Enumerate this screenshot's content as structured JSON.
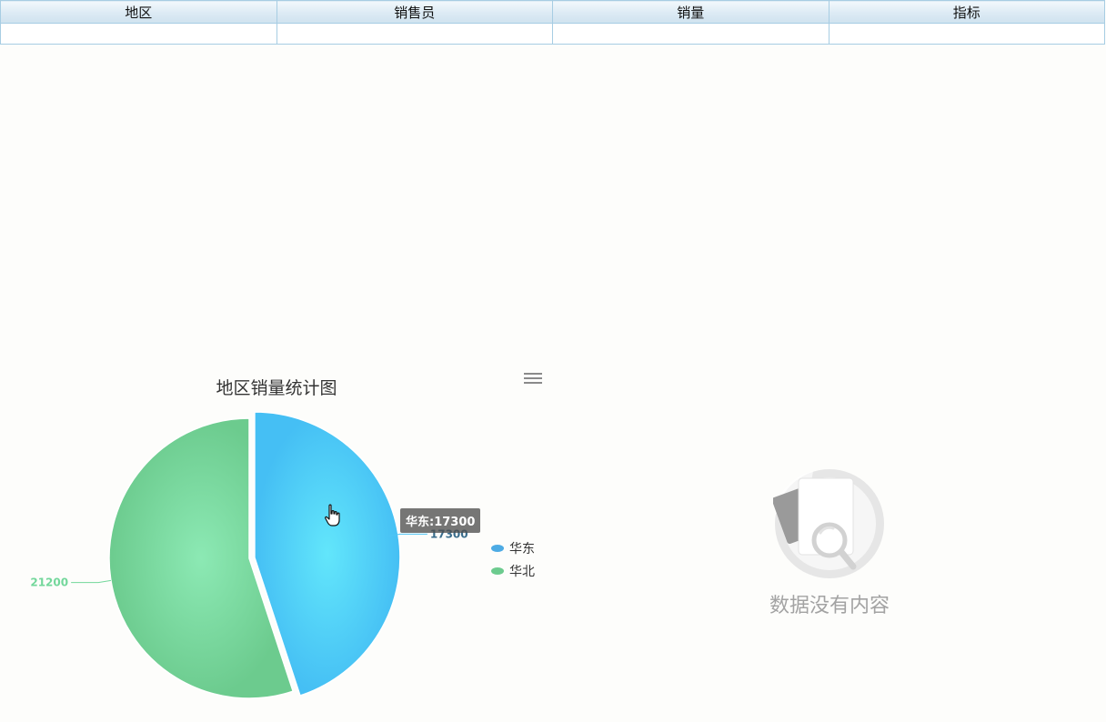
{
  "table": {
    "headers": [
      "地区",
      "销售员",
      "销量",
      "指标"
    ],
    "rows": [
      [
        "",
        "",
        "",
        ""
      ]
    ]
  },
  "chart_data": {
    "type": "pie",
    "title": "地区销量统计图",
    "categories": [
      "华东",
      "华北"
    ],
    "values": [
      17300,
      21200
    ],
    "data_labels": [
      "17300",
      "21200"
    ],
    "colors": [
      "#4dc4f5",
      "#73d79b"
    ],
    "legend_position": "right",
    "start_angle": "top, clockwise",
    "highlighted": "华东"
  },
  "tooltip": {
    "text": "华东:17300"
  },
  "toolbar": {
    "menu_icon": "hamburger-menu-icon"
  },
  "empty_state": {
    "icon": "empty-document-search-icon",
    "text": "数据没有内容"
  }
}
